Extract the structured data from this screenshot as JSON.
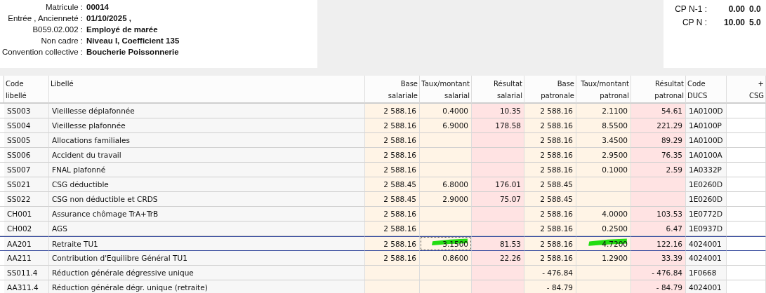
{
  "employee": [
    {
      "label": "Matricule :",
      "value": "00014"
    },
    {
      "label": "Entrée , Ancienneté :",
      "value": "01/10/2025 ,"
    },
    {
      "label": "B059.02.002 :",
      "value": "Employé de marée"
    },
    {
      "label": "Non cadre :",
      "value": "Niveau I, Coefficient 135"
    },
    {
      "label": "Convention collective :",
      "value": "Boucherie Poissonnerie"
    }
  ],
  "leave": [
    {
      "label": "CP N-1 :",
      "values": [
        "0.00",
        "0.0"
      ]
    },
    {
      "label": "CP N :",
      "values": [
        "10.00",
        "5.0"
      ]
    }
  ],
  "table": {
    "columns": [
      {
        "lines": [
          "Code",
          "libellé"
        ],
        "kind": "code"
      },
      {
        "lines": [
          "Libellé"
        ],
        "kind": "text"
      },
      {
        "lines": [
          "Base",
          "salariale"
        ],
        "kind": "base"
      },
      {
        "lines": [
          "Taux/montant",
          "salarial"
        ],
        "kind": "rate"
      },
      {
        "lines": [
          "Résultat",
          "salarial"
        ],
        "kind": "result"
      },
      {
        "lines": [
          "Base",
          "patronale"
        ],
        "kind": "base"
      },
      {
        "lines": [
          "Taux/montant",
          "patronal"
        ],
        "kind": "rate"
      },
      {
        "lines": [
          "Résultat",
          "patronal"
        ],
        "kind": "result"
      },
      {
        "lines": [
          "Code",
          "DUCS"
        ],
        "kind": "code"
      },
      {
        "lines": [
          "+",
          "CSG"
        ],
        "kind": "extra"
      }
    ],
    "rows": [
      {
        "cells": [
          "SS003",
          "Vieillesse déplafonnée",
          "2 588.16",
          "0.4000",
          "10.35",
          "2 588.16",
          "2.1100",
          "54.61",
          "1A0100D"
        ],
        "selected": false,
        "highlighted": false
      },
      {
        "cells": [
          "SS004",
          "Vieillesse plafonnée",
          "2 588.16",
          "6.9000",
          "178.58",
          "2 588.16",
          "8.5500",
          "221.29",
          "1A0100P"
        ],
        "selected": false,
        "highlighted": false
      },
      {
        "cells": [
          "SS005",
          "Allocations familiales",
          "2 588.16",
          null,
          null,
          "2 588.16",
          "3.4500",
          "89.29",
          "1A0100D"
        ],
        "selected": false,
        "highlighted": false
      },
      {
        "cells": [
          "SS006",
          "Accident du travail",
          "2 588.16",
          null,
          null,
          "2 588.16",
          "2.9500",
          "76.35",
          "1A0100A"
        ],
        "selected": false,
        "highlighted": false
      },
      {
        "cells": [
          "SS007",
          "FNAL plafonné",
          "2 588.16",
          null,
          null,
          "2 588.16",
          "0.1000",
          "2.59",
          "1A0332P"
        ],
        "selected": false,
        "highlighted": false
      },
      {
        "cells": [
          "SS021",
          "CSG déductible",
          "2 588.45",
          "6.8000",
          "176.01",
          "2 588.45",
          null,
          null,
          "1E0260D"
        ],
        "selected": false,
        "highlighted": false
      },
      {
        "cells": [
          "SS022",
          "CSG non déductible et CRDS",
          "2 588.45",
          "2.9000",
          "75.07",
          "2 588.45",
          null,
          null,
          "1E0260D"
        ],
        "selected": false,
        "highlighted": false
      },
      {
        "cells": [
          "CH001",
          "Assurance chômage TrA+TrB",
          "2 588.16",
          null,
          null,
          "2 588.16",
          "4.0000",
          "103.53",
          "1E0772D"
        ],
        "selected": false,
        "highlighted": false
      },
      {
        "cells": [
          "CH002",
          "AGS",
          "2 588.16",
          null,
          null,
          "2 588.16",
          "0.2500",
          "6.47",
          "1E0937D"
        ],
        "selected": false,
        "highlighted": false
      },
      {
        "cells": [
          "AA201",
          "Retraite TU1",
          "2 588.16",
          "3.1500",
          "81.53",
          "2 588.16",
          "4.7200",
          "122.16",
          "4024001"
        ],
        "selected": true,
        "highlighted": true
      },
      {
        "cells": [
          "AA211",
          "Contribution d'Equilibre Général TU1",
          "2 588.16",
          "0.8600",
          "22.26",
          "2 588.16",
          "1.2900",
          "33.39",
          "4024001"
        ],
        "selected": false,
        "highlighted": false
      },
      {
        "cells": [
          "SS011.4",
          "Réduction générale dégressive unique",
          null,
          null,
          null,
          "- 476.84",
          null,
          "- 476.84",
          "1F0668"
        ],
        "selected": false,
        "highlighted": false
      },
      {
        "cells": [
          "AA311.4",
          "Réduction générale dégr. unique (retraite)",
          null,
          null,
          null,
          "- 84.79",
          null,
          "- 84.79",
          "4024001"
        ],
        "selected": false,
        "highlighted": false
      }
    ]
  }
}
